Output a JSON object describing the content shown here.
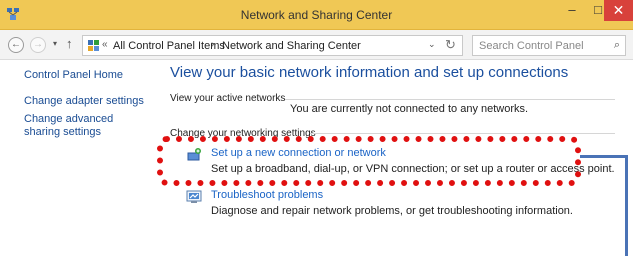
{
  "window": {
    "title": "Network and Sharing Center",
    "minimize": "–",
    "maximize": "□",
    "close": "✕"
  },
  "address": {
    "back": "←",
    "forward": "→",
    "recent": "▾",
    "up": "↑",
    "sep0": "«",
    "crumb1": "All Control Panel Items",
    "sep1": "›",
    "crumb2": "Network and Sharing Center",
    "dropdown": "⌄",
    "refresh": "↻",
    "search_placeholder": "Search Control Panel",
    "search_icon": "⌕"
  },
  "sidebar": {
    "items": [
      {
        "label": "Control Panel Home"
      },
      {
        "label": "Change adapter settings"
      },
      {
        "label": "Change advanced sharing settings"
      }
    ]
  },
  "main": {
    "heading": "View your basic network information and set up connections",
    "active_networks_title": "View your active networks",
    "active_networks_status": "You are currently not connected to any networks.",
    "change_settings_title": "Change your networking settings",
    "tasks": [
      {
        "icon": "new-connection-icon",
        "link": "Set up a new connection or network",
        "desc": "Set up a broadband, dial-up, or VPN connection; or set up a router or access point."
      },
      {
        "icon": "troubleshoot-icon",
        "link": "Troubleshoot problems",
        "desc": "Diagnose and repair network problems, or get troubleshooting information."
      }
    ]
  },
  "colors": {
    "titlebar": "#f0c855",
    "link": "#1b64c6",
    "heading": "#1b4f9e",
    "highlight": "#e01010",
    "close": "#d8413b"
  }
}
